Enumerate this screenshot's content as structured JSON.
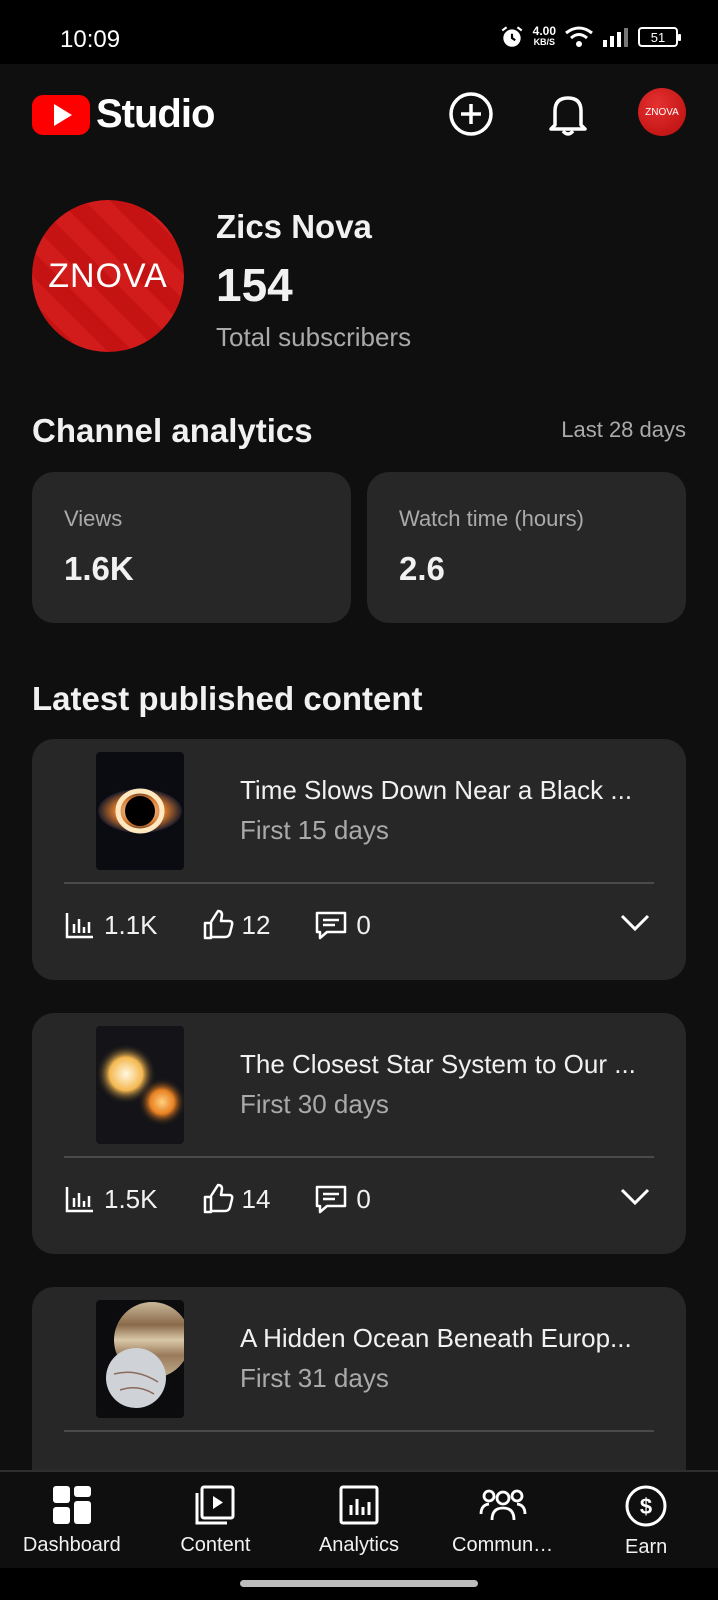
{
  "status_bar": {
    "time": "10:09",
    "net_speed": "4.00",
    "net_unit": "KB/S",
    "battery": "51"
  },
  "header": {
    "logo_text": "Studio",
    "avatar_text": "ZNOVA"
  },
  "profile": {
    "avatar_text": "ZNOVA",
    "channel_name": "Zics Nova",
    "subscriber_count": "154",
    "subscriber_label": "Total subscribers"
  },
  "analytics": {
    "title": "Channel analytics",
    "period": "Last 28 days",
    "cards": [
      {
        "label": "Views",
        "value": "1.6K"
      },
      {
        "label": "Watch time (hours)",
        "value": "2.6"
      }
    ]
  },
  "latest": {
    "title": "Latest published content",
    "items": [
      {
        "title": "Time Slows Down Near a Black ...",
        "period": "First 15 days",
        "views": "1.1K",
        "likes": "12",
        "comments": "0"
      },
      {
        "title": "The Closest Star System to Our ...",
        "period": "First 30 days",
        "views": "1.5K",
        "likes": "14",
        "comments": "0"
      },
      {
        "title": "A Hidden Ocean Beneath Europ...",
        "period": "First 31 days",
        "views": "",
        "likes": "",
        "comments": ""
      }
    ]
  },
  "nav": [
    {
      "label": "Dashboard",
      "icon": "dashboard-icon"
    },
    {
      "label": "Content",
      "icon": "content-icon"
    },
    {
      "label": "Analytics",
      "icon": "analytics-icon"
    },
    {
      "label": "Commun…",
      "icon": "community-icon"
    },
    {
      "label": "Earn",
      "icon": "earn-icon"
    }
  ]
}
